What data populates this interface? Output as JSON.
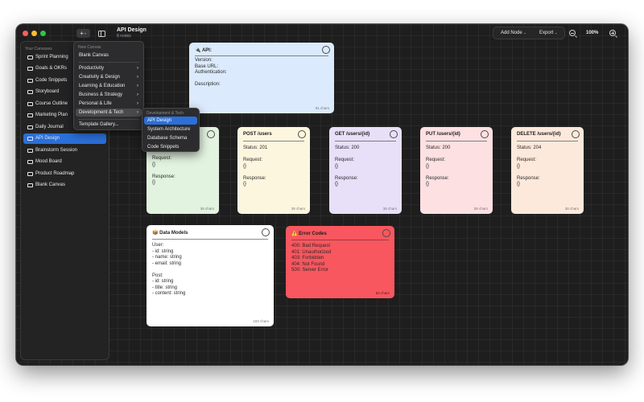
{
  "window": {
    "title": "API Design",
    "subtitle": "8 nodes"
  },
  "toolbar": {
    "add_icon": "+",
    "add_node_label": "Add Node",
    "export_label": "Export",
    "zoom_level": "100%",
    "chevron": "⌄"
  },
  "sidebar": {
    "section_label": "Your Canvases",
    "items": [
      {
        "label": "Sprint Planning"
      },
      {
        "label": "Goals & OKRs"
      },
      {
        "label": "Code Snippets"
      },
      {
        "label": "Storyboard"
      },
      {
        "label": "Course Outline"
      },
      {
        "label": "Marketing Plan"
      },
      {
        "label": "Daily Journal"
      },
      {
        "label": "API Design",
        "active": true
      },
      {
        "label": "Brainstorm Session"
      },
      {
        "label": "Mood Board"
      },
      {
        "label": "Product Roadmap"
      },
      {
        "label": "Blank Canvas"
      }
    ]
  },
  "new_canvas_menu": {
    "header": "New Canvas",
    "blank": "Blank Canvas",
    "categories": [
      {
        "label": "Productivity"
      },
      {
        "label": "Creativity & Design"
      },
      {
        "label": "Learning & Education"
      },
      {
        "label": "Business & Strategy"
      },
      {
        "label": "Personal & Life"
      },
      {
        "label": "Development & Tech",
        "highlighted": true
      }
    ],
    "gallery": "Template Gallery..."
  },
  "submenu": {
    "header": "Development & Tech",
    "items": [
      {
        "label": "API Design",
        "selected": true
      },
      {
        "label": "System Architecture"
      },
      {
        "label": "Database Schema"
      },
      {
        "label": "Code Snippets"
      }
    ]
  },
  "cards": {
    "api": {
      "icon": "🔌",
      "title": "API:",
      "body": "Version:\nBase URL:\nAuthentication:\n\nDescription:",
      "chars": "51 chars",
      "color": "#dbeafc"
    },
    "get_users": {
      "title": "",
      "body": "Request:\n{}\n\nResponse:\n{}",
      "chars": "38 chars",
      "color": "#e2f3df"
    },
    "post_users": {
      "title": "POST /users",
      "body": "Status: 201\n\nRequest:\n{}\n\nResponse:\n{}",
      "chars": "38 chars",
      "color": "#fcf6df"
    },
    "get_user_id": {
      "title": "GET /users/{id}",
      "body": "Status: 200\n\nRequest:\n{}\n\nResponse:\n{}",
      "chars": "38 chars",
      "color": "#e8dff8"
    },
    "put_user_id": {
      "title": "PUT /users/{id}",
      "body": "Status: 200\n\nRequest:\n{}\n\nResponse:\n{}",
      "chars": "38 chars",
      "color": "#fce0e2"
    },
    "delete_user_id": {
      "title": "DELETE /users/{id}",
      "body": "Status: 204\n\nRequest:\n{}\n\nResponse:\n{}",
      "chars": "38 chars",
      "color": "#fde9dc"
    },
    "data_models": {
      "icon": "📦",
      "title": "Data Models",
      "body": "User:\n- id: string\n- name: string\n- email: string\n\nPost:\n- id: string\n- title: string\n- content: string",
      "chars": "103 chars",
      "color": "#ffffff"
    },
    "error_codes": {
      "icon": "⚠️",
      "title": "Error Codes",
      "body": "400: Bad Request\n401: Unauthorized\n403: Forbidden\n404: Not Found\n500: Server Error",
      "chars": "83 chars",
      "color": "#f8575f"
    }
  }
}
